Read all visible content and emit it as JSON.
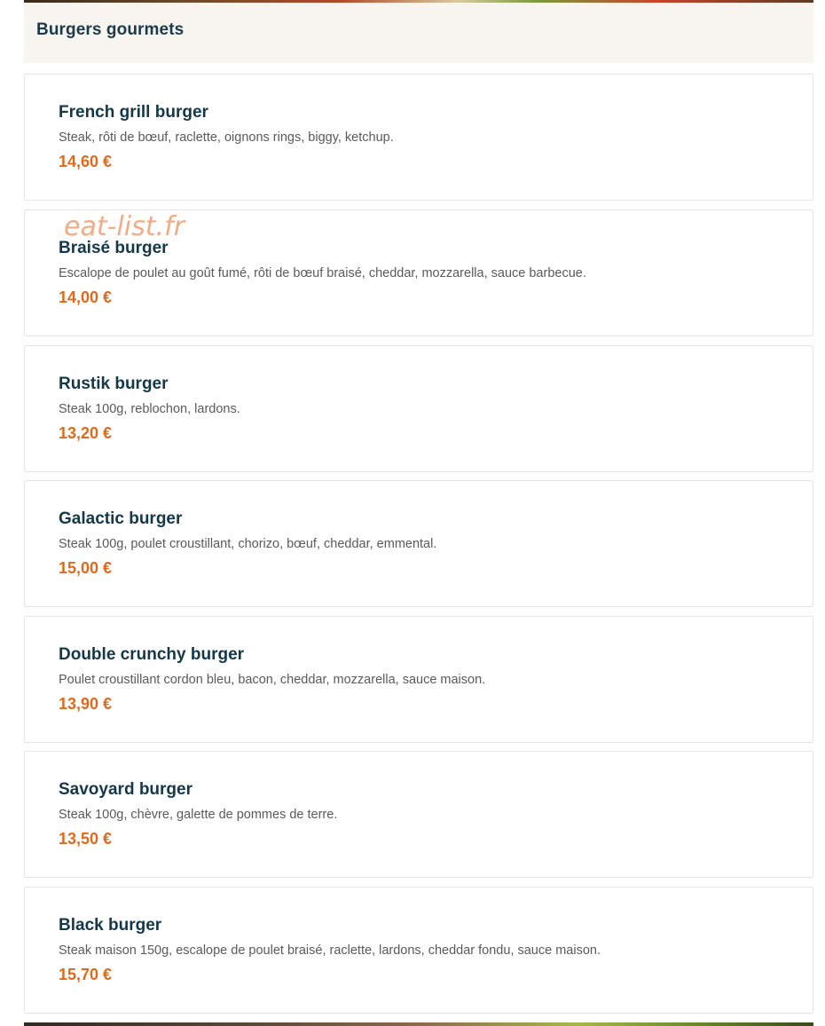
{
  "category": {
    "title": "Burgers gourmets"
  },
  "watermark": "eat-list.fr",
  "items": [
    {
      "name": "French grill burger",
      "description": "Steak, rôti de bœuf, raclette, oignons rings, biggy, ketchup.",
      "price": "14,60 €"
    },
    {
      "name": "Braisé burger",
      "description": "Escalope de poulet au goût fumé, rôti de bœuf braisé, cheddar, mozzarella, sauce barbecue.",
      "price": "14,00 €"
    },
    {
      "name": "Rustik burger",
      "description": "Steak 100g, reblochon, lardons.",
      "price": "13,20 €"
    },
    {
      "name": "Galactic burger",
      "description": "Steak 100g, poulet croustillant, chorizo, bœuf, cheddar, emmental.",
      "price": "15,00 €"
    },
    {
      "name": "Double crunchy burger",
      "description": "Poulet croustillant cordon bleu, bacon, cheddar, mozzarella, sauce maison.",
      "price": "13,90 €"
    },
    {
      "name": "Savoyard burger",
      "description": "Steak 100g, chèvre, galette de pommes de terre.",
      "price": "13,50 €"
    },
    {
      "name": "Black burger",
      "description": "Steak maison 150g, escalope de poulet braisé, raclette, lardons, cheddar fondu, sauce maison.",
      "price": "15,70 €"
    }
  ]
}
